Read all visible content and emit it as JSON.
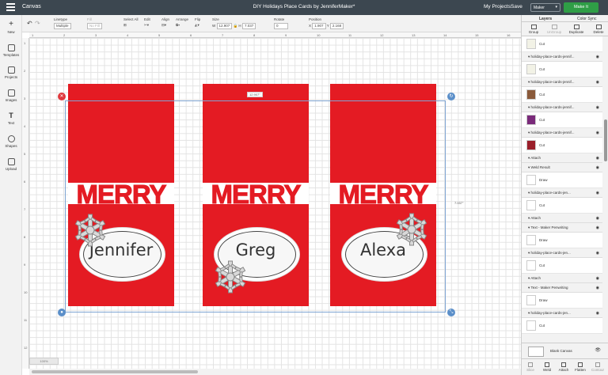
{
  "topbar": {
    "app": "Canvas",
    "title": "DIY Holidays Place Cards by JenniferMaker*",
    "my_projects": "My Projects",
    "save": "Save",
    "machine": "Maker",
    "make_it": "Make It"
  },
  "toolbar": {
    "linetype_label": "Linetype",
    "linetype_value": "Multiple",
    "fill_label": "Fill",
    "fill_value": "No Fill",
    "select_all": "Select All",
    "edit": "Edit",
    "align": "Align",
    "arrange": "Arrange",
    "flip": "Flip",
    "size_label": "Size",
    "w_label": "W",
    "w_value": "12.907",
    "h_label": "H",
    "h_value": "7.037",
    "rotate_label": "Rotate",
    "rotate_value": "0",
    "position_label": "Position",
    "x_label": "X",
    "x_value": "1.907",
    "y_label": "Y",
    "y_value": "2.168"
  },
  "leftbar": [
    "New",
    "Templates",
    "Projects",
    "Images",
    "Text",
    "Shapes",
    "Upload"
  ],
  "ruler_top": [
    "1",
    "2",
    "3",
    "4",
    "5",
    "6",
    "7",
    "8",
    "9",
    "10",
    "11",
    "12",
    "13",
    "14",
    "15",
    "16",
    "17",
    "18",
    "19",
    "20",
    "21",
    "22",
    "23",
    "24"
  ],
  "ruler_left": [
    "1",
    "2",
    "3",
    "4",
    "5",
    "6",
    "7",
    "8",
    "9",
    "10",
    "11",
    "12"
  ],
  "canvas": {
    "width_label": "12.907\"",
    "height_label": "7.037\"",
    "cards": [
      {
        "merry": "MERRY",
        "name": "Jennifer"
      },
      {
        "merry": "MERRY",
        "name": "Greg"
      },
      {
        "merry": "MERRY",
        "name": "Alexa"
      }
    ],
    "zoom": "100%"
  },
  "panel": {
    "tabs": [
      "Layers",
      "Color Sync"
    ],
    "tools": [
      "Group",
      "UnGroup",
      "Duplicate",
      "Delete"
    ],
    "rows": [
      {
        "type": "sub",
        "label": "Cut",
        "thumb": "#f2f2e6"
      },
      {
        "type": "grp",
        "label": "holiday-place-cards-jennif..."
      },
      {
        "type": "sub",
        "label": "Cut",
        "thumb": "#f2f2e6"
      },
      {
        "type": "grp",
        "label": "holiday-place-cards-jennif..."
      },
      {
        "type": "sub",
        "label": "Cut",
        "thumb": "#8a5a3a"
      },
      {
        "type": "grp",
        "label": "holiday-place-cards-jennif..."
      },
      {
        "type": "sub",
        "label": "Cut",
        "thumb": "#7a2a7a"
      },
      {
        "type": "grp",
        "label": "holiday-place-cards-jennif..."
      },
      {
        "type": "sub",
        "label": "Cut",
        "thumb": "#9a1f2a"
      },
      {
        "type": "grp",
        "label": "Attach"
      },
      {
        "type": "grp",
        "label": "Weld Result"
      },
      {
        "type": "sub",
        "label": "Draw",
        "thumb": "#ffffff"
      },
      {
        "type": "grp",
        "label": "holiday-place-cards-jen..."
      },
      {
        "type": "sub",
        "label": "Cut",
        "thumb": "#ffffff"
      },
      {
        "type": "grp",
        "label": "Attach"
      },
      {
        "type": "grp",
        "label": "Text - Maker Penwriting"
      },
      {
        "type": "sub",
        "label": "Draw",
        "thumb": "#ffffff"
      },
      {
        "type": "grp",
        "label": "holiday-place-cards-jen..."
      },
      {
        "type": "sub",
        "label": "Cut",
        "thumb": "#ffffff"
      },
      {
        "type": "grp",
        "label": "Attach"
      },
      {
        "type": "grp",
        "label": "Text - Maker Penwriting"
      },
      {
        "type": "sub",
        "label": "Draw",
        "thumb": "#ffffff"
      },
      {
        "type": "grp",
        "label": "holiday-place-cards-jen..."
      },
      {
        "type": "sub",
        "label": "Cut",
        "thumb": "#ffffff"
      }
    ],
    "blank_canvas": "Blank Canvas",
    "bottom": [
      "Slice",
      "Weld",
      "Attach",
      "Flatten",
      "Contour"
    ]
  },
  "colors": {
    "card_red": "#e41b23",
    "accent_green": "#2f9e46",
    "topbar": "#3c4750"
  }
}
